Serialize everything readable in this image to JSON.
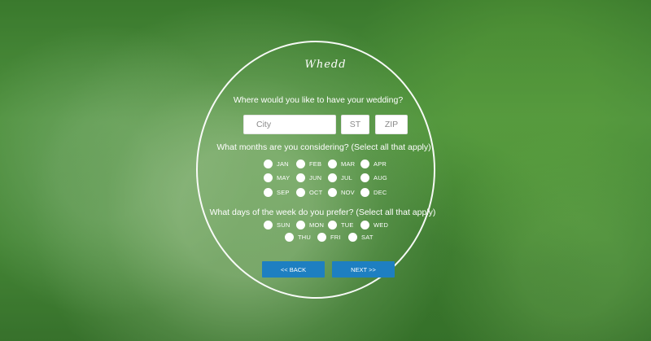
{
  "brand": "Whedd",
  "questions": {
    "location": "Where would you like to have your wedding?",
    "months": "What months are you considering? (Select all that apply)",
    "days": "What days of the week do you prefer? (Select all that apply)"
  },
  "location_fields": {
    "city_placeholder": "City",
    "state_placeholder": "ST",
    "zip_placeholder": "ZIP"
  },
  "months": [
    "JAN",
    "FEB",
    "MAR",
    "APR",
    "MAY",
    "JUN",
    "JUL",
    "AUG",
    "SEP",
    "OCT",
    "NOV",
    "DEC"
  ],
  "days": [
    "SUN",
    "MON",
    "TUE",
    "WED",
    "THU",
    "FRI",
    "SAT"
  ],
  "buttons": {
    "back": "<< BACK",
    "next": "NEXT >>"
  },
  "colors": {
    "accent": "#1e7fc1",
    "overlay": "#4f8a3e"
  }
}
